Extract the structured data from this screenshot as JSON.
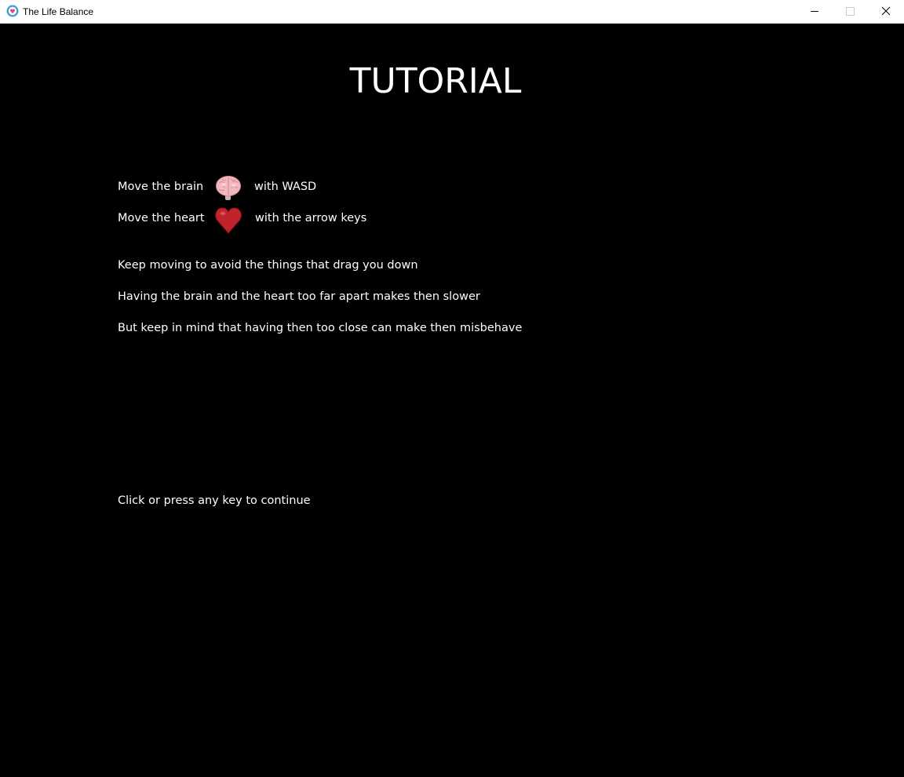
{
  "window": {
    "title": "The Life Balance",
    "app_icon": "heart-circle-icon",
    "controls": {
      "minimize": "minimize-icon",
      "maximize": "maximize-icon",
      "close": "close-icon"
    }
  },
  "tutorial": {
    "heading": "TUTORIAL",
    "brain_line": {
      "prefix": "Move the brain",
      "sprite": "brain-icon",
      "suffix": "with WASD"
    },
    "heart_line": {
      "prefix": "Move the heart",
      "sprite": "heart-icon",
      "suffix": "with the arrow keys"
    },
    "tips": [
      "Keep moving to avoid the things that drag you down",
      "Having the brain and the heart too far apart makes then slower",
      "But keep in mind that having then too close can make then misbehave"
    ],
    "continue_prompt": "Click or press any key to continue"
  },
  "colors": {
    "background": "#000000",
    "text": "#ffffff",
    "brain": "#f2b8c0",
    "heart": "#c0232b",
    "icon_ring": "#3a9fd9",
    "icon_inner": "#e8457a"
  }
}
